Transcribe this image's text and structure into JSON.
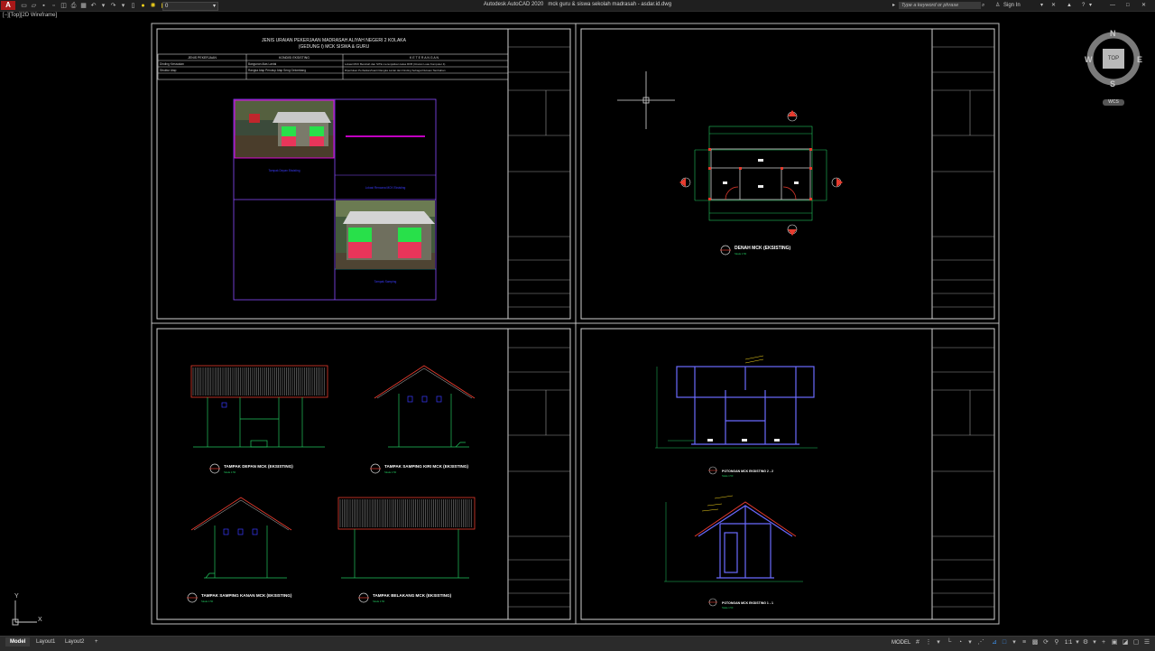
{
  "app": {
    "title": "Autodesk AutoCAD 2020",
    "document": "mck guru & siswa sekolah madrasah - asdar.id.dwg",
    "app_button": "A",
    "workspace_value": "0",
    "search_placeholder": "Type a keyword or phrase",
    "sign_in": "Sign In",
    "help": "?"
  },
  "viewport": {
    "label": "[−][Top][2D Wireframe]"
  },
  "viewcube": {
    "n": "N",
    "s": "S",
    "e": "E",
    "w": "W",
    "top": "TOP",
    "wcs": "WCS"
  },
  "ucs": {
    "x": "X",
    "y": "Y"
  },
  "sheet1": {
    "title_line1": "JENIS URAIAN PEKERJAAN MADRASAH ALIYAH NEGERI 2 KOLAKA",
    "title_line2": "(GEDUNG I) MCK SISWA & GURU",
    "headers": [
      "JENIS PEKERJAAN",
      "KONDISI EKSISTING",
      "K E T E R A N G A N"
    ],
    "rows": [
      [
        "Dinding Kerusakan",
        "Bangunan Atas Lantai",
        "Lokasi MCK Berubah dan SITE menunjukkan kelas RKB (Ukuran Luas Komputer 4)"
      ],
      [
        "Struktur Atap",
        "Rangka Atap Penutup Atap Seng Gelombang",
        "Diperlukan Perbaikan/Ganti Rangka Lantai dan Dinding Sebagai Dukuan Tambahan"
      ]
    ],
    "captions": [
      "Tampak Depan Eksisting",
      "Lokasi Rencana MCK Eksisting",
      "Tampak Samping"
    ]
  },
  "sheet2": {
    "title": "DENAH MCK (EKSISTING)",
    "scale": "Skala 1:50"
  },
  "sheet3": {
    "titles": [
      "TAMPAK DEPAN MCK (EKSISTING)",
      "TAMPAK SAMPING KIRI MCK (EKSISTING)",
      "TAMPAK SAMPING KANAN MCK (EKSISTING)",
      "TAMPAK BELAKANG MCK (EKSISTING)"
    ],
    "scale": "Skala 1:50"
  },
  "sheet4": {
    "titles": [
      "POTONGAN MCK EKSISTING 2 - 2",
      "POTONGAN MCK EKSISTING 1 - 1"
    ],
    "scale": "Skala 1:50"
  },
  "status": {
    "tabs": [
      "Model",
      "Layout1",
      "Layout2"
    ],
    "add_tab": "+",
    "model_label": "MODEL",
    "scale": "1:1"
  },
  "colors": {
    "title_bg": "#1f1f1f",
    "frame": "#bdbdbd",
    "magenta": "#ff00ff",
    "blue": "#3b3bff",
    "green": "#22c55e",
    "red": "#e63b2e"
  }
}
